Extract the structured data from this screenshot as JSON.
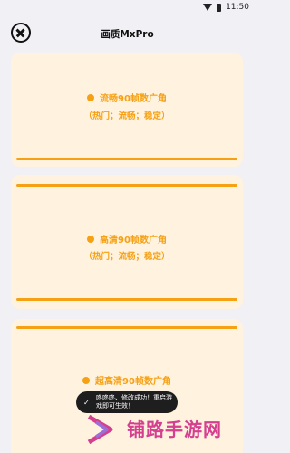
{
  "status_bar": {
    "time": "11:50"
  },
  "header": {
    "title": "画质MxPro"
  },
  "options": [
    {
      "name": "流畅90帧数广角",
      "tags": "（热门；流畅；稳定）"
    },
    {
      "name": "高清90帧数广角",
      "tags": "（热门；流畅；稳定）"
    },
    {
      "name": "超高清90帧数广角",
      "tags": ""
    }
  ],
  "toast": {
    "icon": "check-icon",
    "text": "咚咚咚、修改成功！重启游戏即可生效！"
  },
  "watermark": {
    "text": "铺路手游网"
  },
  "colors": {
    "accent": "#f6a114",
    "card_bg": "#fff3e0",
    "page_bg": "#f1f0f5",
    "watermark": "#d43f8f"
  }
}
